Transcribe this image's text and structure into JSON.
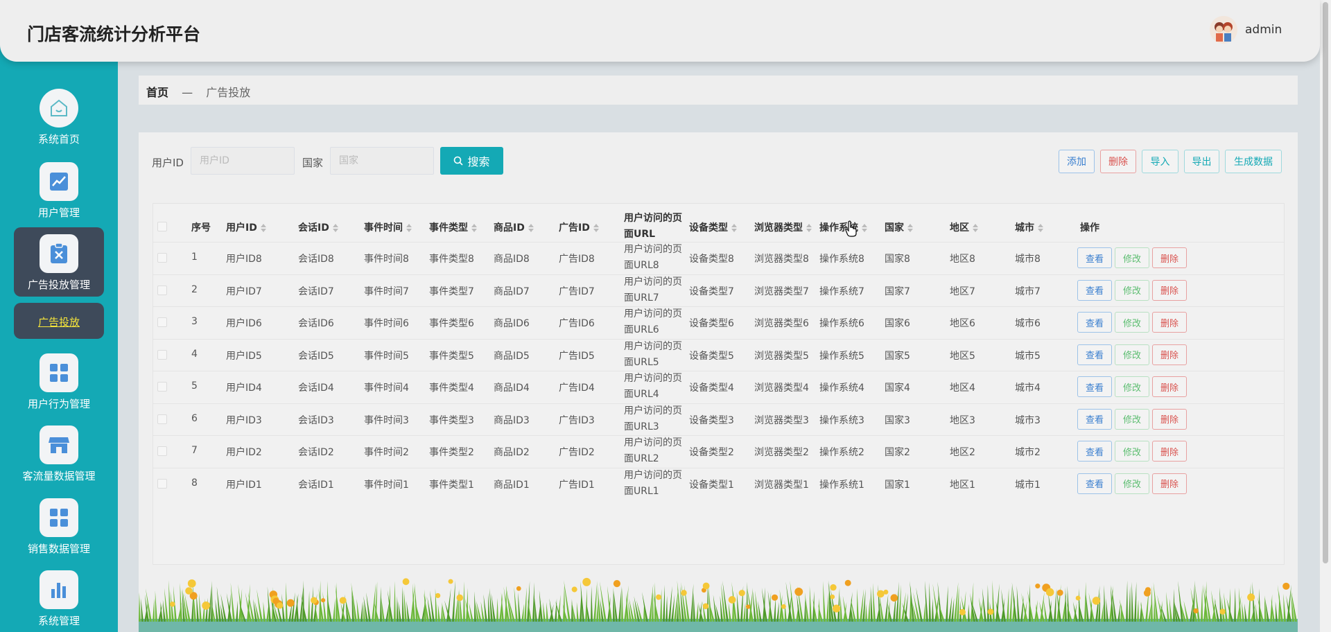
{
  "header": {
    "title": "门店客流统计分析平台",
    "user": "admin"
  },
  "sidebar": {
    "items": [
      {
        "label": "系统首页",
        "icon": "home-icon"
      },
      {
        "label": "用户管理",
        "icon": "chart-line-icon"
      },
      {
        "label": "广告投放管理",
        "icon": "clipboard-x-icon",
        "active": true
      },
      {
        "label": "用户行为管理",
        "icon": "grid-icon"
      },
      {
        "label": "客流量数据管理",
        "icon": "store-icon"
      },
      {
        "label": "销售数据管理",
        "icon": "grid-icon"
      },
      {
        "label": "系统管理",
        "icon": "bar-chart-icon"
      }
    ],
    "sub_item": "广告投放"
  },
  "breadcrumb": {
    "home": "首页",
    "separator": "—",
    "current": "广告投放"
  },
  "search": {
    "user_id_label": "用户ID",
    "user_id_placeholder": "用户ID",
    "country_label": "国家",
    "country_placeholder": "国家",
    "button": "搜索"
  },
  "toolbar": {
    "add": "添加",
    "delete": "删除",
    "import": "导入",
    "export": "导出",
    "generate": "生成数据"
  },
  "table": {
    "headers": [
      "序号",
      "用户ID",
      "会话ID",
      "事件时间",
      "事件类型",
      "商品ID",
      "广告ID",
      "用户访问的页面URL",
      "设备类型",
      "浏览器类型",
      "操作系统",
      "国家",
      "地区",
      "城市",
      "操作"
    ],
    "rows": [
      [
        "1",
        "用户ID8",
        "会话ID8",
        "事件时间8",
        "事件类型8",
        "商品ID8",
        "广告ID8",
        "用户访问的页面URL8",
        "设备类型8",
        "浏览器类型8",
        "操作系统8",
        "国家8",
        "地区8",
        "城市8"
      ],
      [
        "2",
        "用户ID7",
        "会话ID7",
        "事件时间7",
        "事件类型7",
        "商品ID7",
        "广告ID7",
        "用户访问的页面URL7",
        "设备类型7",
        "浏览器类型7",
        "操作系统7",
        "国家7",
        "地区7",
        "城市7"
      ],
      [
        "3",
        "用户ID6",
        "会话ID6",
        "事件时间6",
        "事件类型6",
        "商品ID6",
        "广告ID6",
        "用户访问的页面URL6",
        "设备类型6",
        "浏览器类型6",
        "操作系统6",
        "国家6",
        "地区6",
        "城市6"
      ],
      [
        "4",
        "用户ID5",
        "会话ID5",
        "事件时间5",
        "事件类型5",
        "商品ID5",
        "广告ID5",
        "用户访问的页面URL5",
        "设备类型5",
        "浏览器类型5",
        "操作系统5",
        "国家5",
        "地区5",
        "城市5"
      ],
      [
        "5",
        "用户ID4",
        "会话ID4",
        "事件时间4",
        "事件类型4",
        "商品ID4",
        "广告ID4",
        "用户访问的页面URL4",
        "设备类型4",
        "浏览器类型4",
        "操作系统4",
        "国家4",
        "地区4",
        "城市4"
      ],
      [
        "6",
        "用户ID3",
        "会话ID3",
        "事件时间3",
        "事件类型3",
        "商品ID3",
        "广告ID3",
        "用户访问的页面URL3",
        "设备类型3",
        "浏览器类型3",
        "操作系统3",
        "国家3",
        "地区3",
        "城市3"
      ],
      [
        "7",
        "用户ID2",
        "会话ID2",
        "事件时间2",
        "事件类型2",
        "商品ID2",
        "广告ID2",
        "用户访问的页面URL2",
        "设备类型2",
        "浏览器类型2",
        "操作系统2",
        "国家2",
        "地区2",
        "城市2"
      ],
      [
        "8",
        "用户ID1",
        "会话ID1",
        "事件时间1",
        "事件类型1",
        "商品ID1",
        "广告ID1",
        "用户访问的页面URL1",
        "设备类型1",
        "浏览器类型1",
        "操作系统1",
        "国家1",
        "地区1",
        "城市1"
      ]
    ],
    "actions": {
      "view": "查看",
      "edit": "修改",
      "delete": "删除"
    }
  },
  "colors": {
    "primary": "#14a9b5",
    "sidebar_active": "#3e4a5a",
    "sub_item_text": "#f7e63a"
  }
}
